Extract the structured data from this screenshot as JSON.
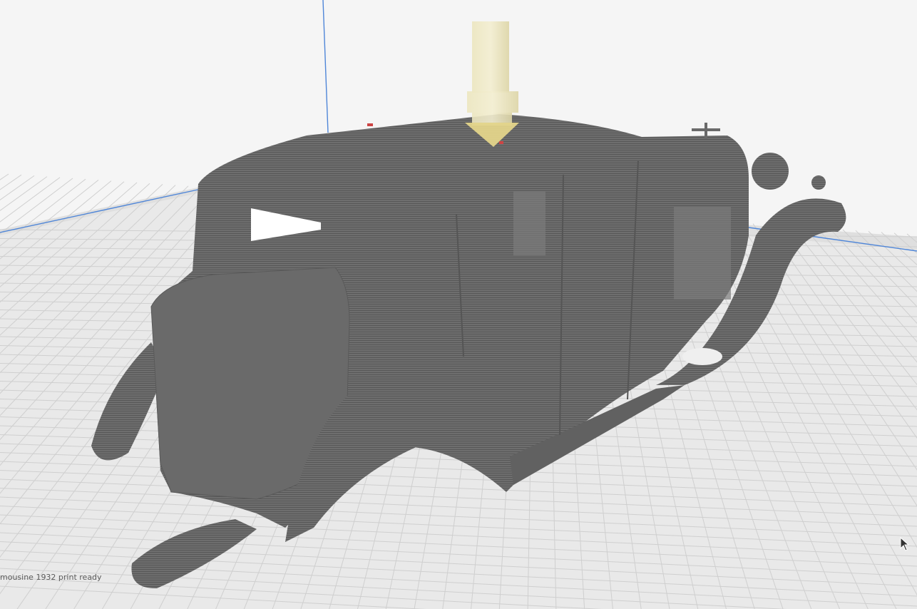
{
  "viewport": {
    "object_label": "mousine 1932 print ready",
    "background_color": "#f5f5f5",
    "build_plate_color": "#e9e9e9",
    "grid_line_color": "#cfcfcf",
    "axis_y_color": "#4f86d8",
    "model_color": "#6b6b6b",
    "nozzle_color": "#e6e0b8"
  }
}
